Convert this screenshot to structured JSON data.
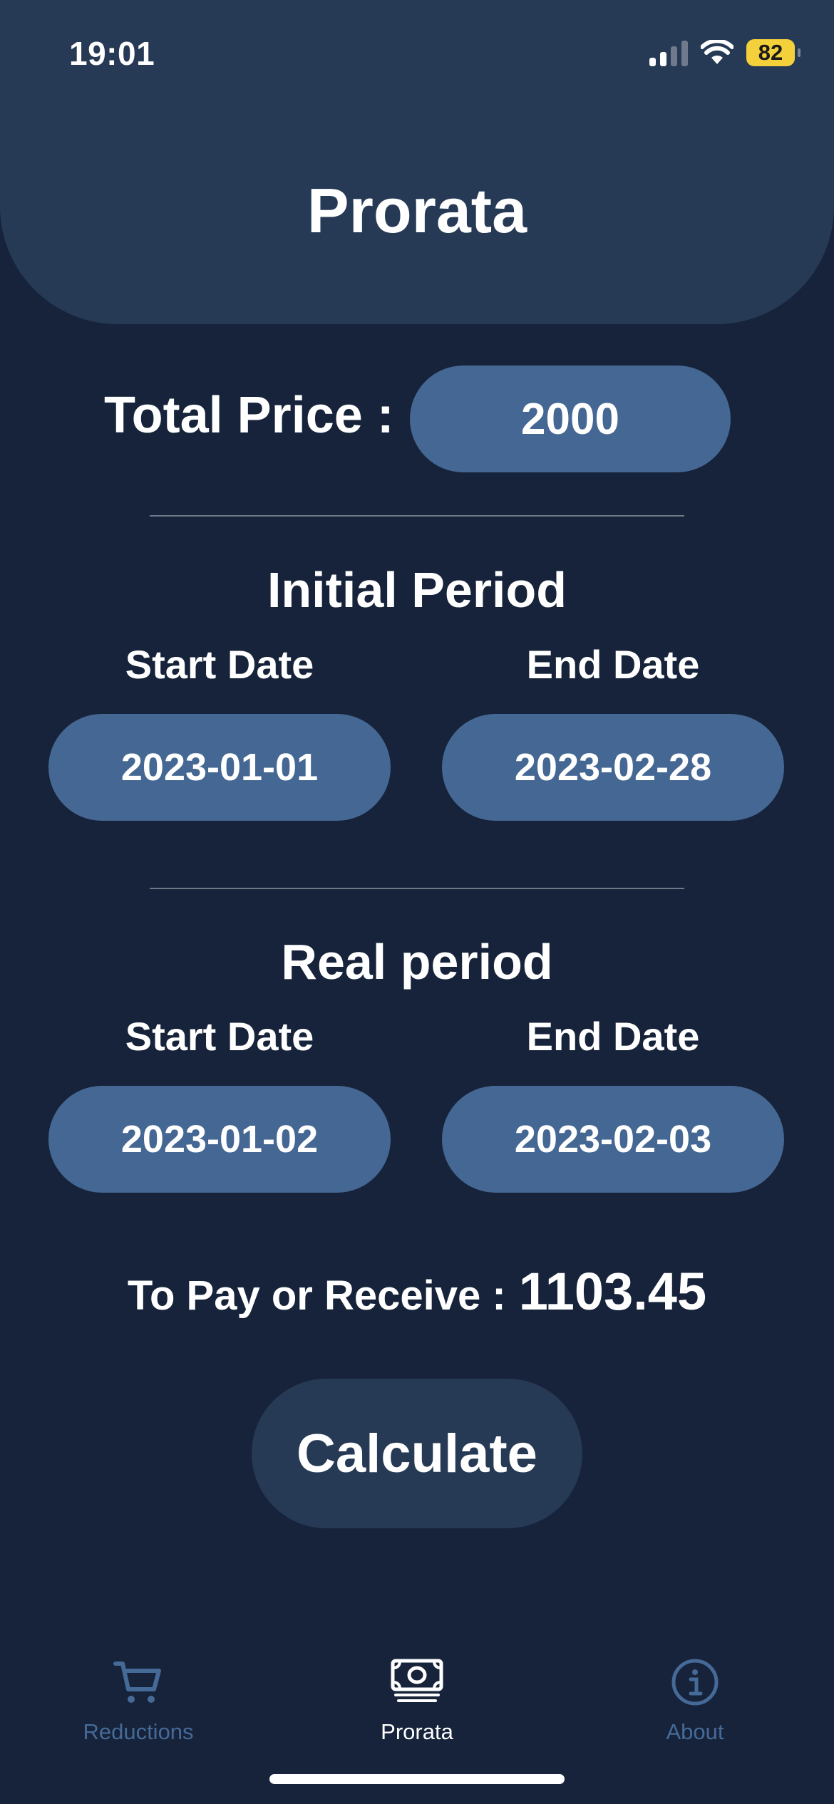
{
  "status_bar": {
    "time": "19:01",
    "battery": "82"
  },
  "header": {
    "title": "Prorata"
  },
  "total_price": {
    "label": "Total Price :",
    "value": "2000"
  },
  "initial_period": {
    "title": "Initial Period",
    "start_label": "Start Date",
    "end_label": "End Date",
    "start_value": "2023-01-01",
    "end_value": "2023-02-28"
  },
  "real_period": {
    "title": "Real period",
    "start_label": "Start Date",
    "end_label": "End Date",
    "start_value": "2023-01-02",
    "end_value": "2023-02-03"
  },
  "result": {
    "label": "To Pay or Receive :",
    "value": "1103.45"
  },
  "calculate_button": {
    "label": "Calculate"
  },
  "tabs": [
    {
      "label": "Reductions",
      "icon": "cart-icon",
      "active": false
    },
    {
      "label": "Prorata",
      "icon": "banknote-icon",
      "active": true
    },
    {
      "label": "About",
      "icon": "info-icon",
      "active": false
    }
  ],
  "colors": {
    "background": "#16233a",
    "header": "#263955",
    "pill": "#456793",
    "inactive_tab": "#466a98",
    "battery": "#f4d13b"
  }
}
